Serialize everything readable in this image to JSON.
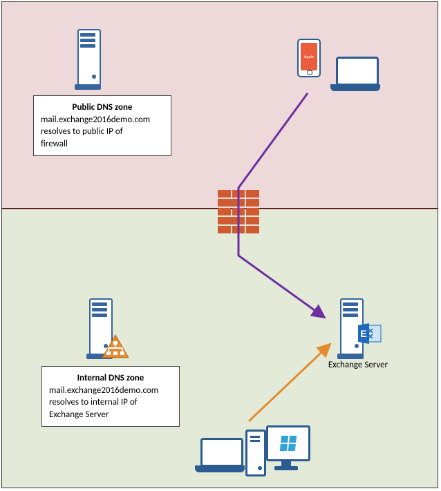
{
  "zones": {
    "public": {
      "textbox": {
        "title": "Public DNS zone",
        "line1": "mail.exchange2016demo.com",
        "line2": "resolves to public IP of",
        "line3": "firewall"
      },
      "phone_label": "Apple"
    },
    "internal": {
      "textbox": {
        "title": "Internal DNS zone",
        "line1": "mail.exchange2016demo.com",
        "line2": "resolves to internal IP of",
        "line3": "Exchange Server"
      }
    }
  },
  "labels": {
    "exchange_server": "Exchange Server"
  },
  "icons": {
    "dns": "sitemap-icon",
    "exchange": "exchange-icon",
    "firewall": "firewall-icon",
    "windows": "windows-icon"
  },
  "arrows": {
    "external_to_exchange": {
      "color": "#6b2fa0"
    },
    "internal_to_exchange": {
      "color": "#e38b2f"
    }
  }
}
